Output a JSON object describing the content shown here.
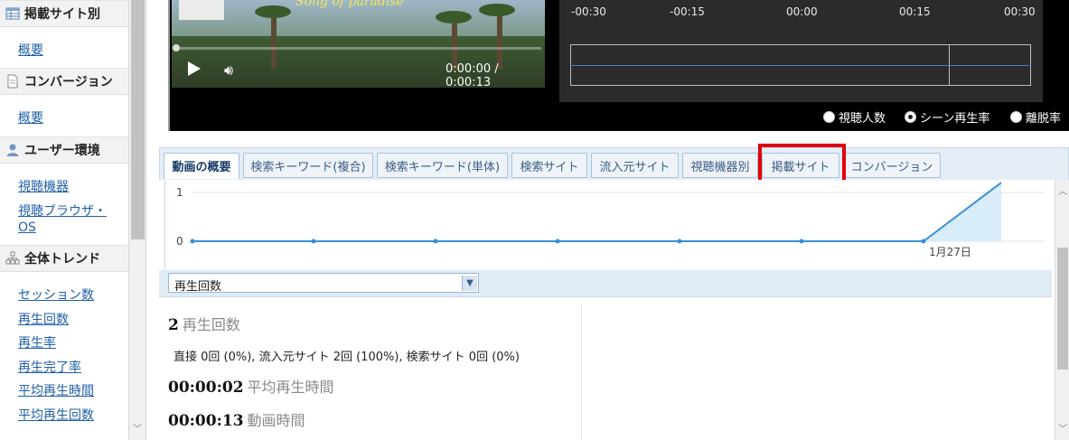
{
  "sidebar": {
    "sections": [
      {
        "title": "掲載サイト別",
        "icon": "table-icon",
        "links": [
          "概要"
        ]
      },
      {
        "title": "コンバージョン",
        "icon": "document-icon",
        "links": [
          "概要"
        ]
      },
      {
        "title": "ユーザー環境",
        "icon": "user-icon",
        "links": [
          "視聴機器",
          "視聴ブラウザ・OS"
        ]
      },
      {
        "title": "全体トレンド",
        "icon": "sitemap-icon",
        "links": [
          "セッション数",
          "再生回数",
          "再生率",
          "再生完了率",
          "平均再生時間",
          "平均再生回数"
        ]
      }
    ]
  },
  "video": {
    "title_overlay": "Song of paradise",
    "time": "0:00:00 / 0:00:13"
  },
  "timeline": {
    "ticks": [
      "-00:30",
      "-00:15",
      "00:00",
      "00:15",
      "00:30"
    ]
  },
  "radios": {
    "options": [
      "視聴人数",
      "シーン再生率",
      "離脱率"
    ],
    "selected_index": 1
  },
  "tabs": {
    "items": [
      "動画の概要",
      "検索キーワード(複合)",
      "検索キーワード(単体)",
      "検索サイト",
      "流入元サイト",
      "視聴機器別",
      "掲載サイト",
      "コンバージョン"
    ],
    "active_index": 0,
    "highlighted_index": 6
  },
  "chart_data": {
    "type": "area",
    "y_tick_labels": [
      "0",
      "1"
    ],
    "x_label": "1月27日",
    "ylim": [
      0,
      1
    ],
    "series": [
      {
        "values": [
          0,
          0,
          0,
          0,
          0,
          0,
          0,
          1.2
        ]
      }
    ],
    "line_color": "#3a8fd6",
    "fill_color": "#d9ecf9"
  },
  "metric_select": {
    "value": "再生回数"
  },
  "stats": {
    "plays": {
      "value": "2",
      "label": "再生回数"
    },
    "breakdown": "直接 0回 (0%), 流入元サイト 2回 (100%), 検索サイト 0回 (0%)",
    "avg_time": {
      "value": "00:00:02",
      "label": "平均再生時間"
    },
    "video_time": {
      "value": "00:00:13",
      "label": "動画時間"
    }
  },
  "colors": {
    "highlight": "#e0000a",
    "link": "#1f5fa8",
    "tab_text": "#3a5d86"
  }
}
